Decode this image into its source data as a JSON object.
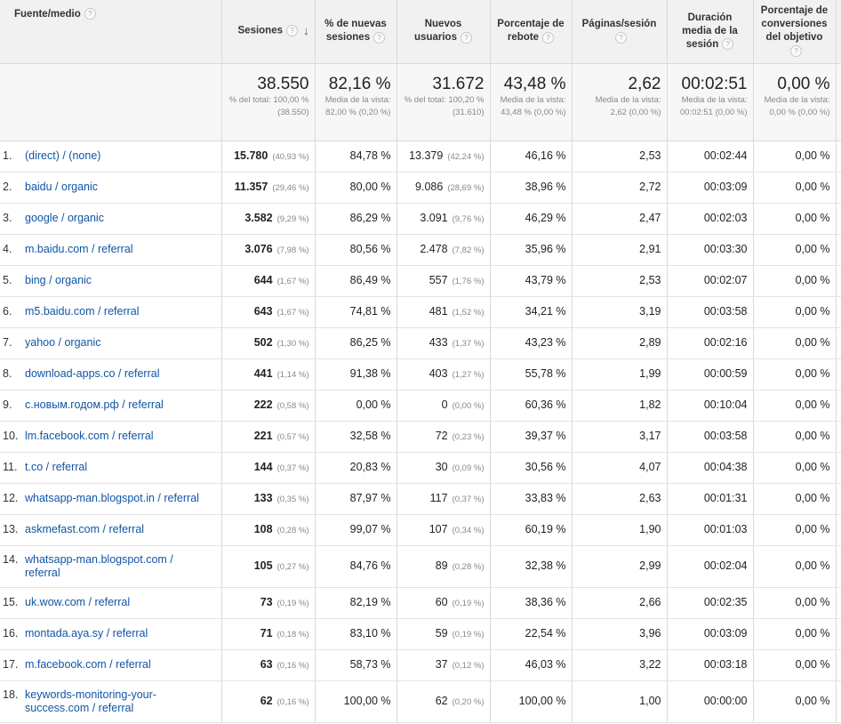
{
  "headers": {
    "source": "Fuente/medio",
    "sessions": "Sesiones",
    "new_sessions": "% de nuevas sesiones",
    "new_users": "Nuevos usuarios",
    "bounce": "Porcentaje de rebote",
    "pages": "Páginas/sesión",
    "duration": "Duración media de la sesión",
    "conversion": "Porcentaje de conversiones del objetivo",
    "help_icon_text": "?",
    "sort_arrow": "↓"
  },
  "totals": {
    "sessions": {
      "value": "38.550",
      "sub": "% del total: 100,00 % (38.550)"
    },
    "new_sessions": {
      "value": "82,16 %",
      "sub": "Media de la vista: 82,00 % (0,20 %)"
    },
    "new_users": {
      "value": "31.672",
      "sub": "% del total: 100,20 % (31.610)"
    },
    "bounce": {
      "value": "43,48 %",
      "sub": "Media de la vista: 43,48 % (0,00 %)"
    },
    "pages": {
      "value": "2,62",
      "sub": "Media de la vista: 2,62 (0,00 %)"
    },
    "duration": {
      "value": "00:02:51",
      "sub": "Media de la vista: 00:02:51 (0,00 %)"
    },
    "conversion": {
      "value": "0,00 %",
      "sub": "Media de la vista: 0,00 % (0,00 %)"
    }
  },
  "rows": [
    {
      "idx": "1.",
      "source": "(direct) / (none)",
      "sessions": "15.780",
      "sessions_pct": "(40,93 %)",
      "new_sessions": "84,78 %",
      "new_users": "13.379",
      "new_users_pct": "(42,24 %)",
      "bounce": "46,16 %",
      "pages": "2,53",
      "duration": "00:02:44",
      "conversion": "0,00 %"
    },
    {
      "idx": "2.",
      "source": "baidu / organic",
      "sessions": "11.357",
      "sessions_pct": "(29,46 %)",
      "new_sessions": "80,00 %",
      "new_users": "9.086",
      "new_users_pct": "(28,69 %)",
      "bounce": "38,96 %",
      "pages": "2,72",
      "duration": "00:03:09",
      "conversion": "0,00 %"
    },
    {
      "idx": "3.",
      "source": "google / organic",
      "sessions": "3.582",
      "sessions_pct": "(9,29 %)",
      "new_sessions": "86,29 %",
      "new_users": "3.091",
      "new_users_pct": "(9,76 %)",
      "bounce": "46,29 %",
      "pages": "2,47",
      "duration": "00:02:03",
      "conversion": "0,00 %"
    },
    {
      "idx": "4.",
      "source": "m.baidu.com / referral",
      "sessions": "3.076",
      "sessions_pct": "(7,98 %)",
      "new_sessions": "80,56 %",
      "new_users": "2.478",
      "new_users_pct": "(7,82 %)",
      "bounce": "35,96 %",
      "pages": "2,91",
      "duration": "00:03:30",
      "conversion": "0,00 %"
    },
    {
      "idx": "5.",
      "source": "bing / organic",
      "sessions": "644",
      "sessions_pct": "(1,67 %)",
      "new_sessions": "86,49 %",
      "new_users": "557",
      "new_users_pct": "(1,76 %)",
      "bounce": "43,79 %",
      "pages": "2,53",
      "duration": "00:02:07",
      "conversion": "0,00 %"
    },
    {
      "idx": "6.",
      "source": "m5.baidu.com / referral",
      "sessions": "643",
      "sessions_pct": "(1,67 %)",
      "new_sessions": "74,81 %",
      "new_users": "481",
      "new_users_pct": "(1,52 %)",
      "bounce": "34,21 %",
      "pages": "3,19",
      "duration": "00:03:58",
      "conversion": "0,00 %"
    },
    {
      "idx": "7.",
      "source": "yahoo / organic",
      "sessions": "502",
      "sessions_pct": "(1,30 %)",
      "new_sessions": "86,25 %",
      "new_users": "433",
      "new_users_pct": "(1,37 %)",
      "bounce": "43,23 %",
      "pages": "2,89",
      "duration": "00:02:16",
      "conversion": "0,00 %"
    },
    {
      "idx": "8.",
      "source": "download-apps.co / referral",
      "sessions": "441",
      "sessions_pct": "(1,14 %)",
      "new_sessions": "91,38 %",
      "new_users": "403",
      "new_users_pct": "(1,27 %)",
      "bounce": "55,78 %",
      "pages": "1,99",
      "duration": "00:00:59",
      "conversion": "0,00 %"
    },
    {
      "idx": "9.",
      "source": "с.новым.годом.рф / referral",
      "sessions": "222",
      "sessions_pct": "(0,58 %)",
      "new_sessions": "0,00 %",
      "new_users": "0",
      "new_users_pct": "(0,00 %)",
      "bounce": "60,36 %",
      "pages": "1,82",
      "duration": "00:10:04",
      "conversion": "0,00 %"
    },
    {
      "idx": "10.",
      "source": "lm.facebook.com / referral",
      "sessions": "221",
      "sessions_pct": "(0,57 %)",
      "new_sessions": "32,58 %",
      "new_users": "72",
      "new_users_pct": "(0,23 %)",
      "bounce": "39,37 %",
      "pages": "3,17",
      "duration": "00:03:58",
      "conversion": "0,00 %"
    },
    {
      "idx": "11.",
      "source": "t.co / referral",
      "sessions": "144",
      "sessions_pct": "(0,37 %)",
      "new_sessions": "20,83 %",
      "new_users": "30",
      "new_users_pct": "(0,09 %)",
      "bounce": "30,56 %",
      "pages": "4,07",
      "duration": "00:04:38",
      "conversion": "0,00 %"
    },
    {
      "idx": "12.",
      "source": "whatsapp-man.blogspot.in / referral",
      "sessions": "133",
      "sessions_pct": "(0,35 %)",
      "new_sessions": "87,97 %",
      "new_users": "117",
      "new_users_pct": "(0,37 %)",
      "bounce": "33,83 %",
      "pages": "2,63",
      "duration": "00:01:31",
      "conversion": "0,00 %"
    },
    {
      "idx": "13.",
      "source": "askmefast.com / referral",
      "sessions": "108",
      "sessions_pct": "(0,28 %)",
      "new_sessions": "99,07 %",
      "new_users": "107",
      "new_users_pct": "(0,34 %)",
      "bounce": "60,19 %",
      "pages": "1,90",
      "duration": "00:01:03",
      "conversion": "0,00 %"
    },
    {
      "idx": "14.",
      "source": "whatsapp-man.blogspot.com / referral",
      "sessions": "105",
      "sessions_pct": "(0,27 %)",
      "new_sessions": "84,76 %",
      "new_users": "89",
      "new_users_pct": "(0,28 %)",
      "bounce": "32,38 %",
      "pages": "2,99",
      "duration": "00:02:04",
      "conversion": "0,00 %"
    },
    {
      "idx": "15.",
      "source": "uk.wow.com / referral",
      "sessions": "73",
      "sessions_pct": "(0,19 %)",
      "new_sessions": "82,19 %",
      "new_users": "60",
      "new_users_pct": "(0,19 %)",
      "bounce": "38,36 %",
      "pages": "2,66",
      "duration": "00:02:35",
      "conversion": "0,00 %"
    },
    {
      "idx": "16.",
      "source": "montada.aya.sy / referral",
      "sessions": "71",
      "sessions_pct": "(0,18 %)",
      "new_sessions": "83,10 %",
      "new_users": "59",
      "new_users_pct": "(0,19 %)",
      "bounce": "22,54 %",
      "pages": "3,96",
      "duration": "00:03:09",
      "conversion": "0,00 %"
    },
    {
      "idx": "17.",
      "source": "m.facebook.com / referral",
      "sessions": "63",
      "sessions_pct": "(0,16 %)",
      "new_sessions": "58,73 %",
      "new_users": "37",
      "new_users_pct": "(0,12 %)",
      "bounce": "46,03 %",
      "pages": "3,22",
      "duration": "00:03:18",
      "conversion": "0,00 %"
    },
    {
      "idx": "18.",
      "source": "keywords-monitoring-your-success.com / referral",
      "sessions": "62",
      "sessions_pct": "(0,16 %)",
      "new_sessions": "100,00 %",
      "new_users": "62",
      "new_users_pct": "(0,20 %)",
      "bounce": "100,00 %",
      "pages": "1,00",
      "duration": "00:00:00",
      "conversion": "0,00 %"
    }
  ]
}
